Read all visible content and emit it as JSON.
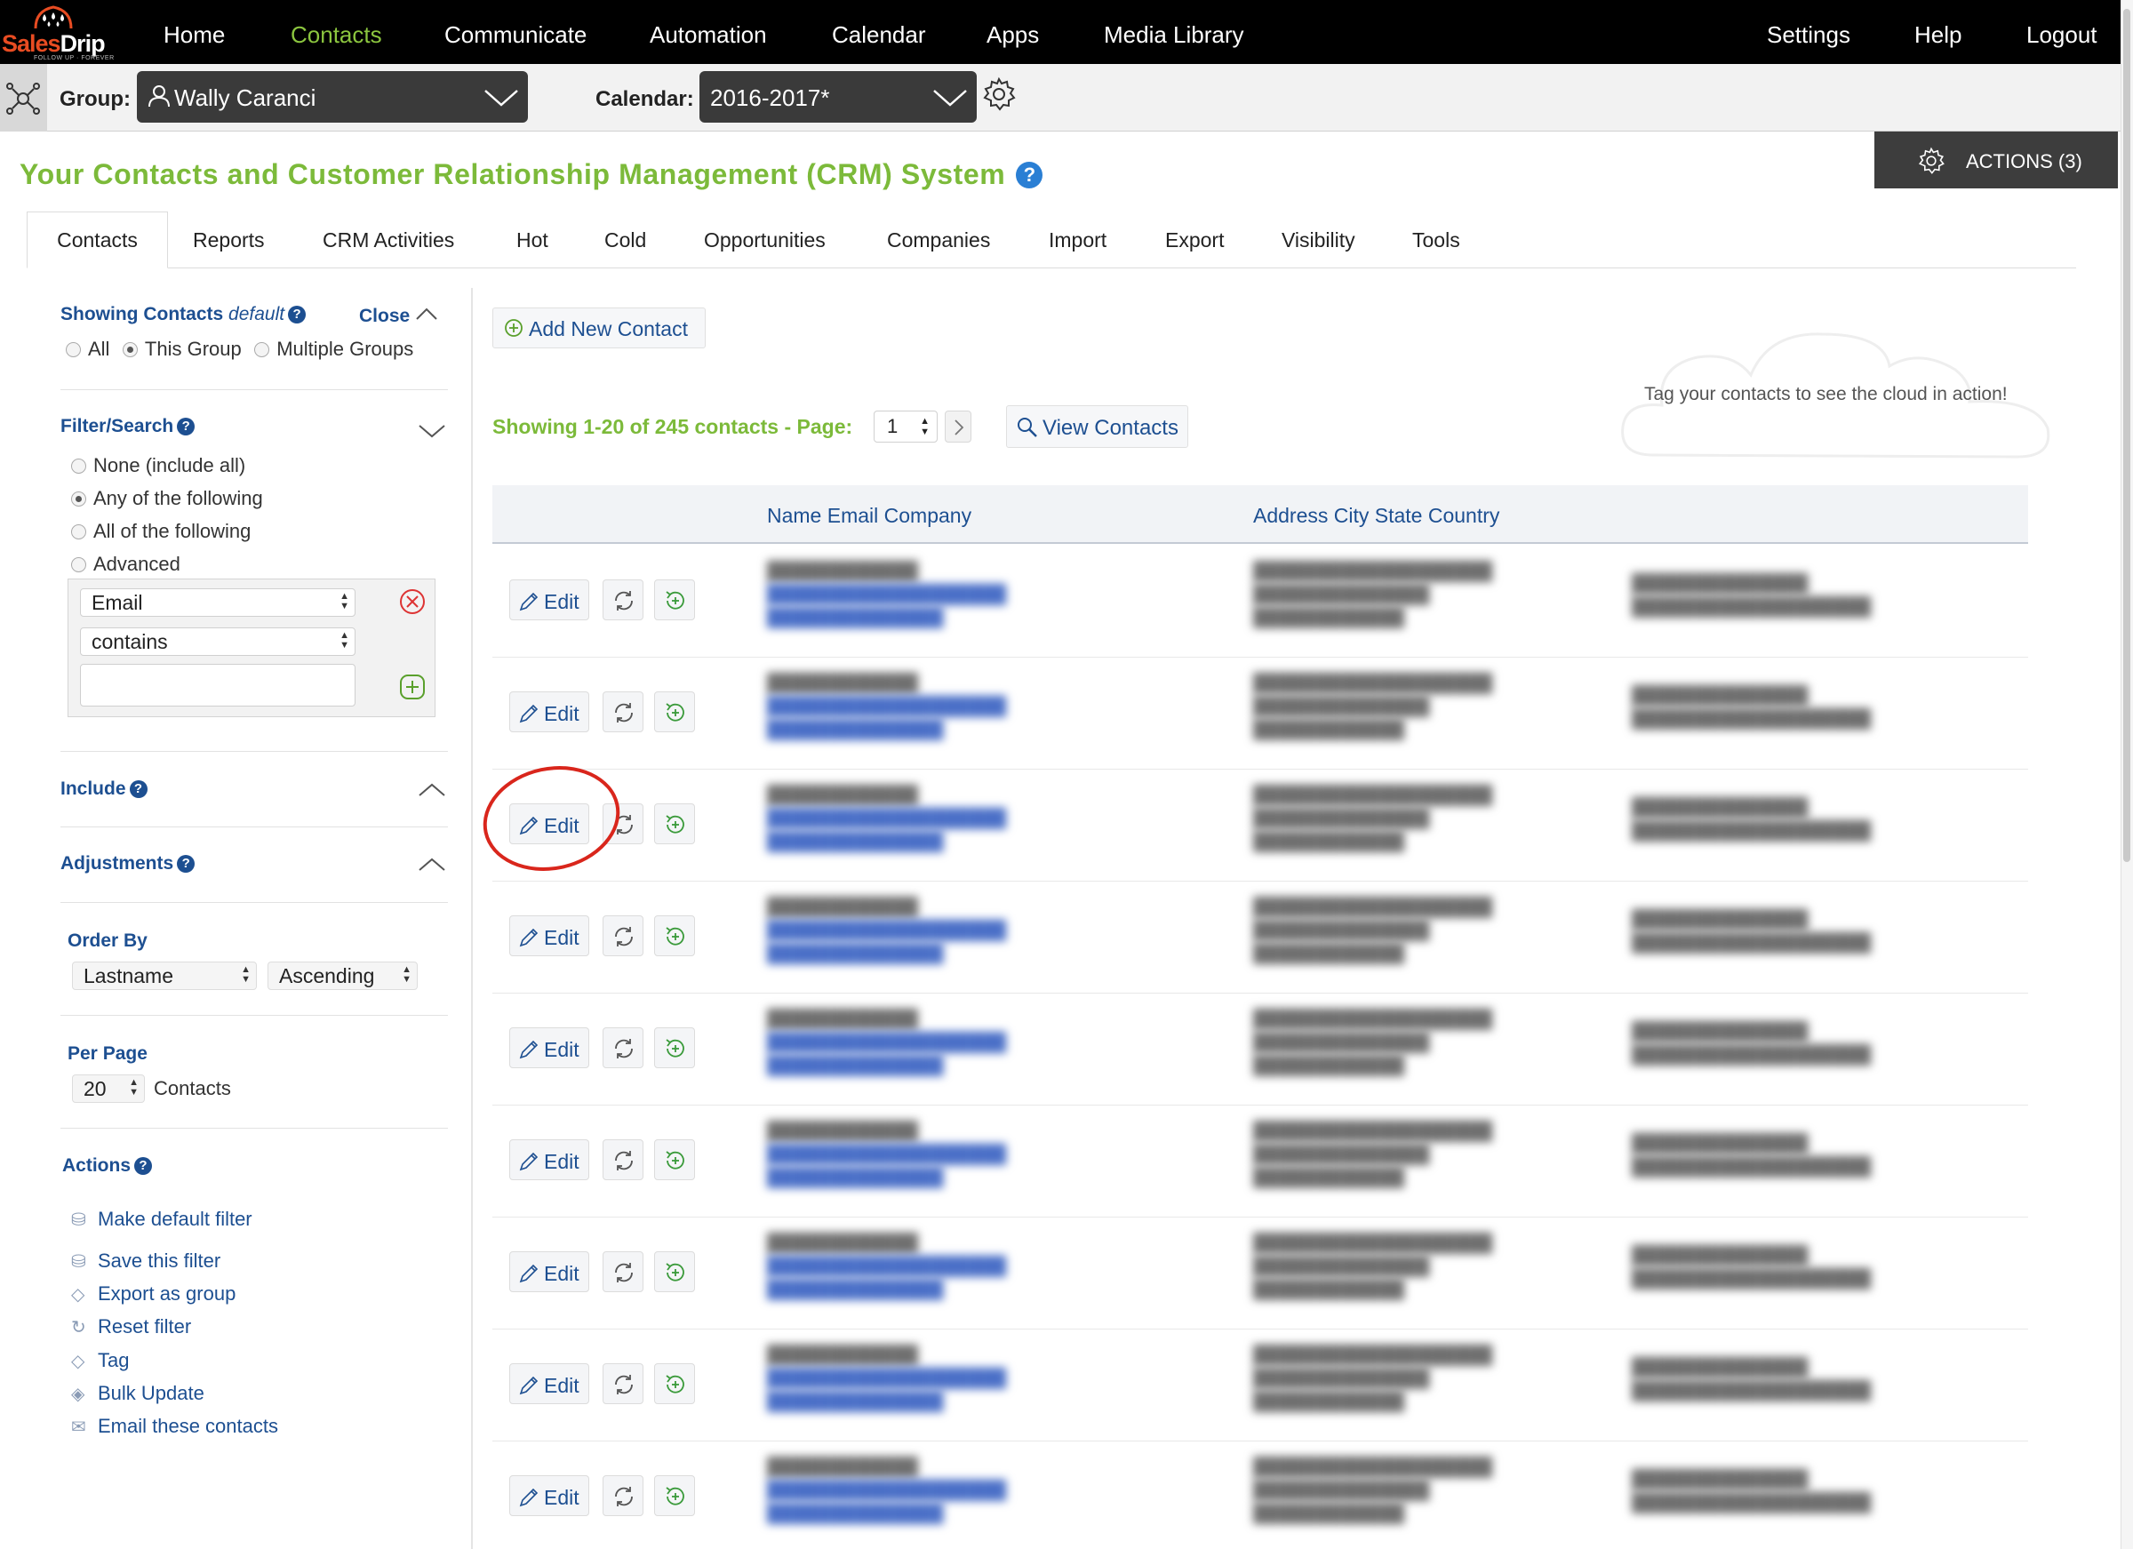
{
  "brand": {
    "name_part1": "Sales",
    "name_part2": "Drip",
    "tagline": "FOLLOW UP · FOREVER"
  },
  "nav": {
    "items": [
      "Home",
      "Contacts",
      "Communicate",
      "Automation",
      "Calendar",
      "Apps",
      "Media Library"
    ],
    "active": "Contacts",
    "right_items": [
      "Settings",
      "Help",
      "Logout"
    ]
  },
  "subbar": {
    "group_label": "Group:",
    "group_value": "Wally Caranci",
    "calendar_label": "Calendar:",
    "calendar_value": "2016-2017*"
  },
  "page": {
    "title": "Your Contacts and Customer Relationship Management (CRM) System",
    "help_glyph": "?",
    "actions_label": "ACTIONS (3)"
  },
  "tabs": [
    "Contacts",
    "Reports",
    "CRM Activities",
    "Hot",
    "Cold",
    "Opportunities",
    "Companies",
    "Import",
    "Export",
    "Visibility",
    "Tools"
  ],
  "sidebar": {
    "showing_label": "Showing Contacts",
    "showing_mode": "default",
    "close_label": "Close",
    "scope_options": [
      "All",
      "This Group",
      "Multiple Groups"
    ],
    "scope_selected": "This Group",
    "filter_title": "Filter/Search",
    "filter_options": [
      "None (include all)",
      "Any of the following",
      "All of the following",
      "Advanced"
    ],
    "filter_selected": "Any of the following",
    "filter_field": "Email",
    "filter_operator": "contains",
    "filter_value": "",
    "include_title": "Include",
    "adjustments_title": "Adjustments",
    "order_by_title": "Order By",
    "order_by_field": "Lastname",
    "order_by_direction": "Ascending",
    "per_page_title": "Per Page",
    "per_page_value": "20",
    "per_page_unit": "Contacts",
    "actions_title": "Actions",
    "action_items": [
      {
        "label": "Make default filter",
        "icon": "stack-icon"
      },
      {
        "label": "Save this filter",
        "icon": "stack-icon"
      },
      {
        "label": "Export as group",
        "icon": "tag-icon"
      },
      {
        "label": "Reset filter",
        "icon": "refresh-icon"
      },
      {
        "label": "Tag",
        "icon": "tag-icon"
      },
      {
        "label": "Bulk Update",
        "icon": "layers-icon"
      },
      {
        "label": "Email these contacts",
        "icon": "envelope-icon"
      }
    ]
  },
  "main": {
    "add_contact_label": "Add New Contact",
    "showing_text": "Showing 1-20 of 245 contacts - Page:",
    "page_value": "1",
    "view_contacts_label": "View Contacts",
    "cloud_text": "Tag your contacts to see the cloud in action!",
    "columns": [
      "Name Email Company",
      "Address City State Country"
    ],
    "edit_label": "Edit",
    "row_count_visible": 9
  },
  "colors": {
    "brand_green": "#7cba3a",
    "link_blue": "#1d4f91",
    "nav_active": "#8cc63f",
    "highlight_red": "#d9261c"
  }
}
